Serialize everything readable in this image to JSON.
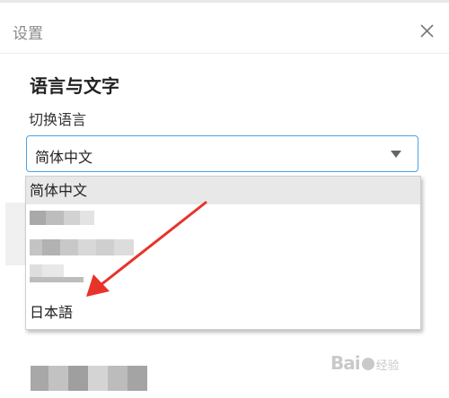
{
  "dialog": {
    "title": "设置",
    "close_icon": "close-icon"
  },
  "language_section": {
    "heading": "语言与文字",
    "field_label": "切换语言",
    "selected_value": "简体中文",
    "caret_icon": "caret-down-icon",
    "options": [
      {
        "label": "简体中文",
        "selected": true
      },
      {
        "label": "",
        "obscured": true
      },
      {
        "label": "",
        "obscured": true
      },
      {
        "label": "",
        "obscured": true
      },
      {
        "label": "日本語",
        "selected": false
      }
    ]
  },
  "annotation": {
    "arrow_color": "#e8332b"
  },
  "watermark": {
    "brand": "Bai",
    "brand2": "经验"
  },
  "colors": {
    "accent_border": "#4aa3e8",
    "selected_bg": "#e8e8e8"
  }
}
